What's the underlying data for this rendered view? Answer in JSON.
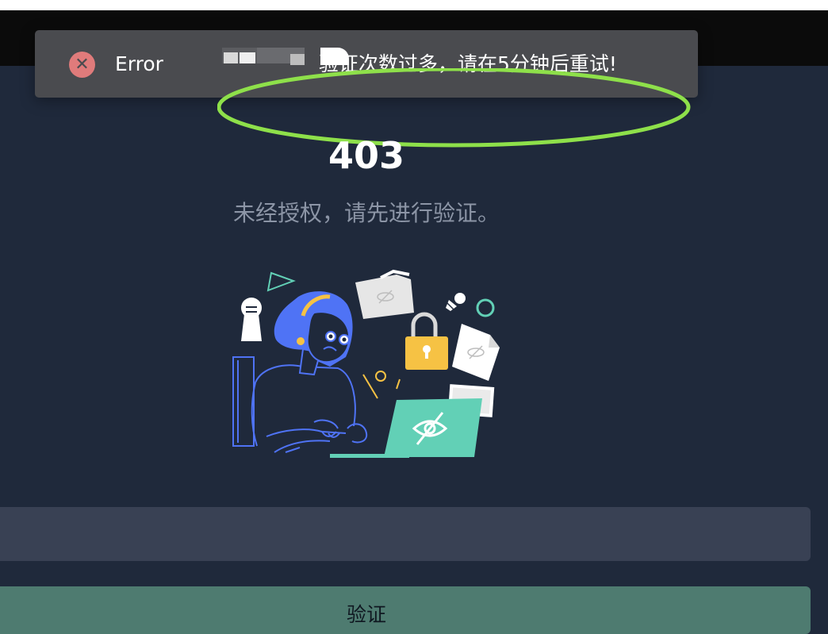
{
  "toast": {
    "label": "Error",
    "message": "验证次数过多，请在5分钟后重试!",
    "icon": "close-circle-icon",
    "icon_color": "#e07b7b",
    "highlight_color": "#8ee04a"
  },
  "page": {
    "code": "403",
    "subtitle": "未经授权，请先进行验证。"
  },
  "form": {
    "input_value": "",
    "verify_label": "验证"
  },
  "colors": {
    "background": "#1f293b",
    "accent_green": "#62d0b6",
    "button": "#4e7b70",
    "input": "#394154"
  }
}
